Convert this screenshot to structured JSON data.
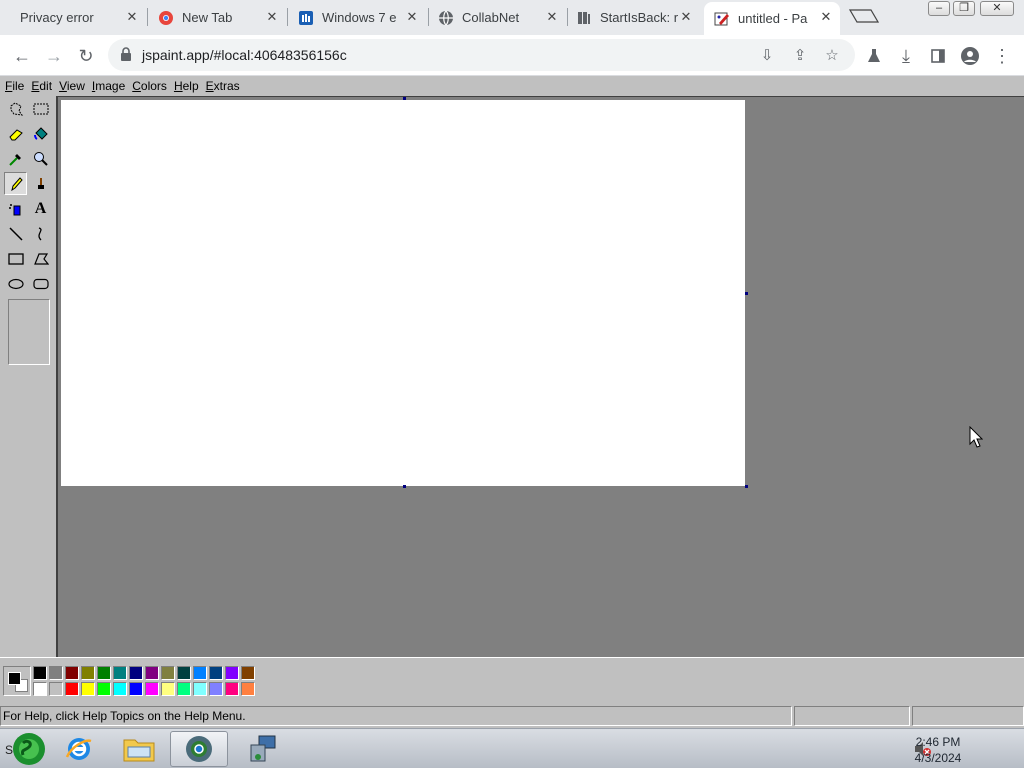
{
  "browser": {
    "tabs": [
      {
        "title": "Privacy error",
        "icon": "warning-icon",
        "active": false
      },
      {
        "title": "New Tab",
        "icon": "chrome-icon",
        "active": false
      },
      {
        "title": "Windows 7 e",
        "icon": "chart-icon",
        "active": false
      },
      {
        "title": "CollabNet",
        "icon": "globe-icon",
        "active": false
      },
      {
        "title": "StartIsBack: r",
        "icon": "book-icon",
        "active": false
      },
      {
        "title": "untitled - Pa",
        "icon": "paint-icon",
        "active": true
      }
    ],
    "url": "jspaint.app/#local:40648356156c",
    "window_controls": [
      "minimize",
      "restore",
      "close"
    ]
  },
  "paint": {
    "menus": [
      {
        "label": "File",
        "accel": "F",
        "rest": "ile"
      },
      {
        "label": "Edit",
        "accel": "E",
        "rest": "dit"
      },
      {
        "label": "View",
        "accel": "V",
        "rest": "iew"
      },
      {
        "label": "Image",
        "accel": "I",
        "rest": "mage"
      },
      {
        "label": "Colors",
        "accel": "C",
        "rest": "olors"
      },
      {
        "label": "Help",
        "accel": "H",
        "rest": "elp"
      },
      {
        "label": "Extras",
        "accel": "E",
        "rest": "xtras"
      }
    ],
    "tools": [
      "free-form-select",
      "rectangle-select",
      "eraser",
      "fill-with-color",
      "pick-color",
      "magnifier",
      "pencil",
      "brush",
      "airbrush",
      "text",
      "line",
      "curve",
      "rectangle",
      "polygon",
      "ellipse",
      "rounded-rectangle"
    ],
    "selected_tool": "pencil",
    "palette": {
      "foreground": "#000000",
      "background": "#ffffff",
      "row1": [
        "#000000",
        "#808080",
        "#800000",
        "#808000",
        "#008000",
        "#008080",
        "#000080",
        "#800080",
        "#808040",
        "#004040",
        "#0080ff",
        "#004080",
        "#8000ff",
        "#804000"
      ],
      "row2": [
        "#ffffff",
        "#c0c0c0",
        "#ff0000",
        "#ffff00",
        "#00ff00",
        "#00ffff",
        "#0000ff",
        "#ff00ff",
        "#ffff80",
        "#00ff80",
        "#80ffff",
        "#8080ff",
        "#ff0080",
        "#ff8040"
      ]
    },
    "status": {
      "help_text": "For Help, click Help Topics on the Help Menu.",
      "position": "",
      "size": ""
    }
  },
  "taskbar": {
    "items": [
      "start-orb",
      "internet-explorer",
      "file-explorer",
      "chrome",
      "network-app"
    ],
    "time": "2:46 PM",
    "date": "4/3/2024"
  }
}
